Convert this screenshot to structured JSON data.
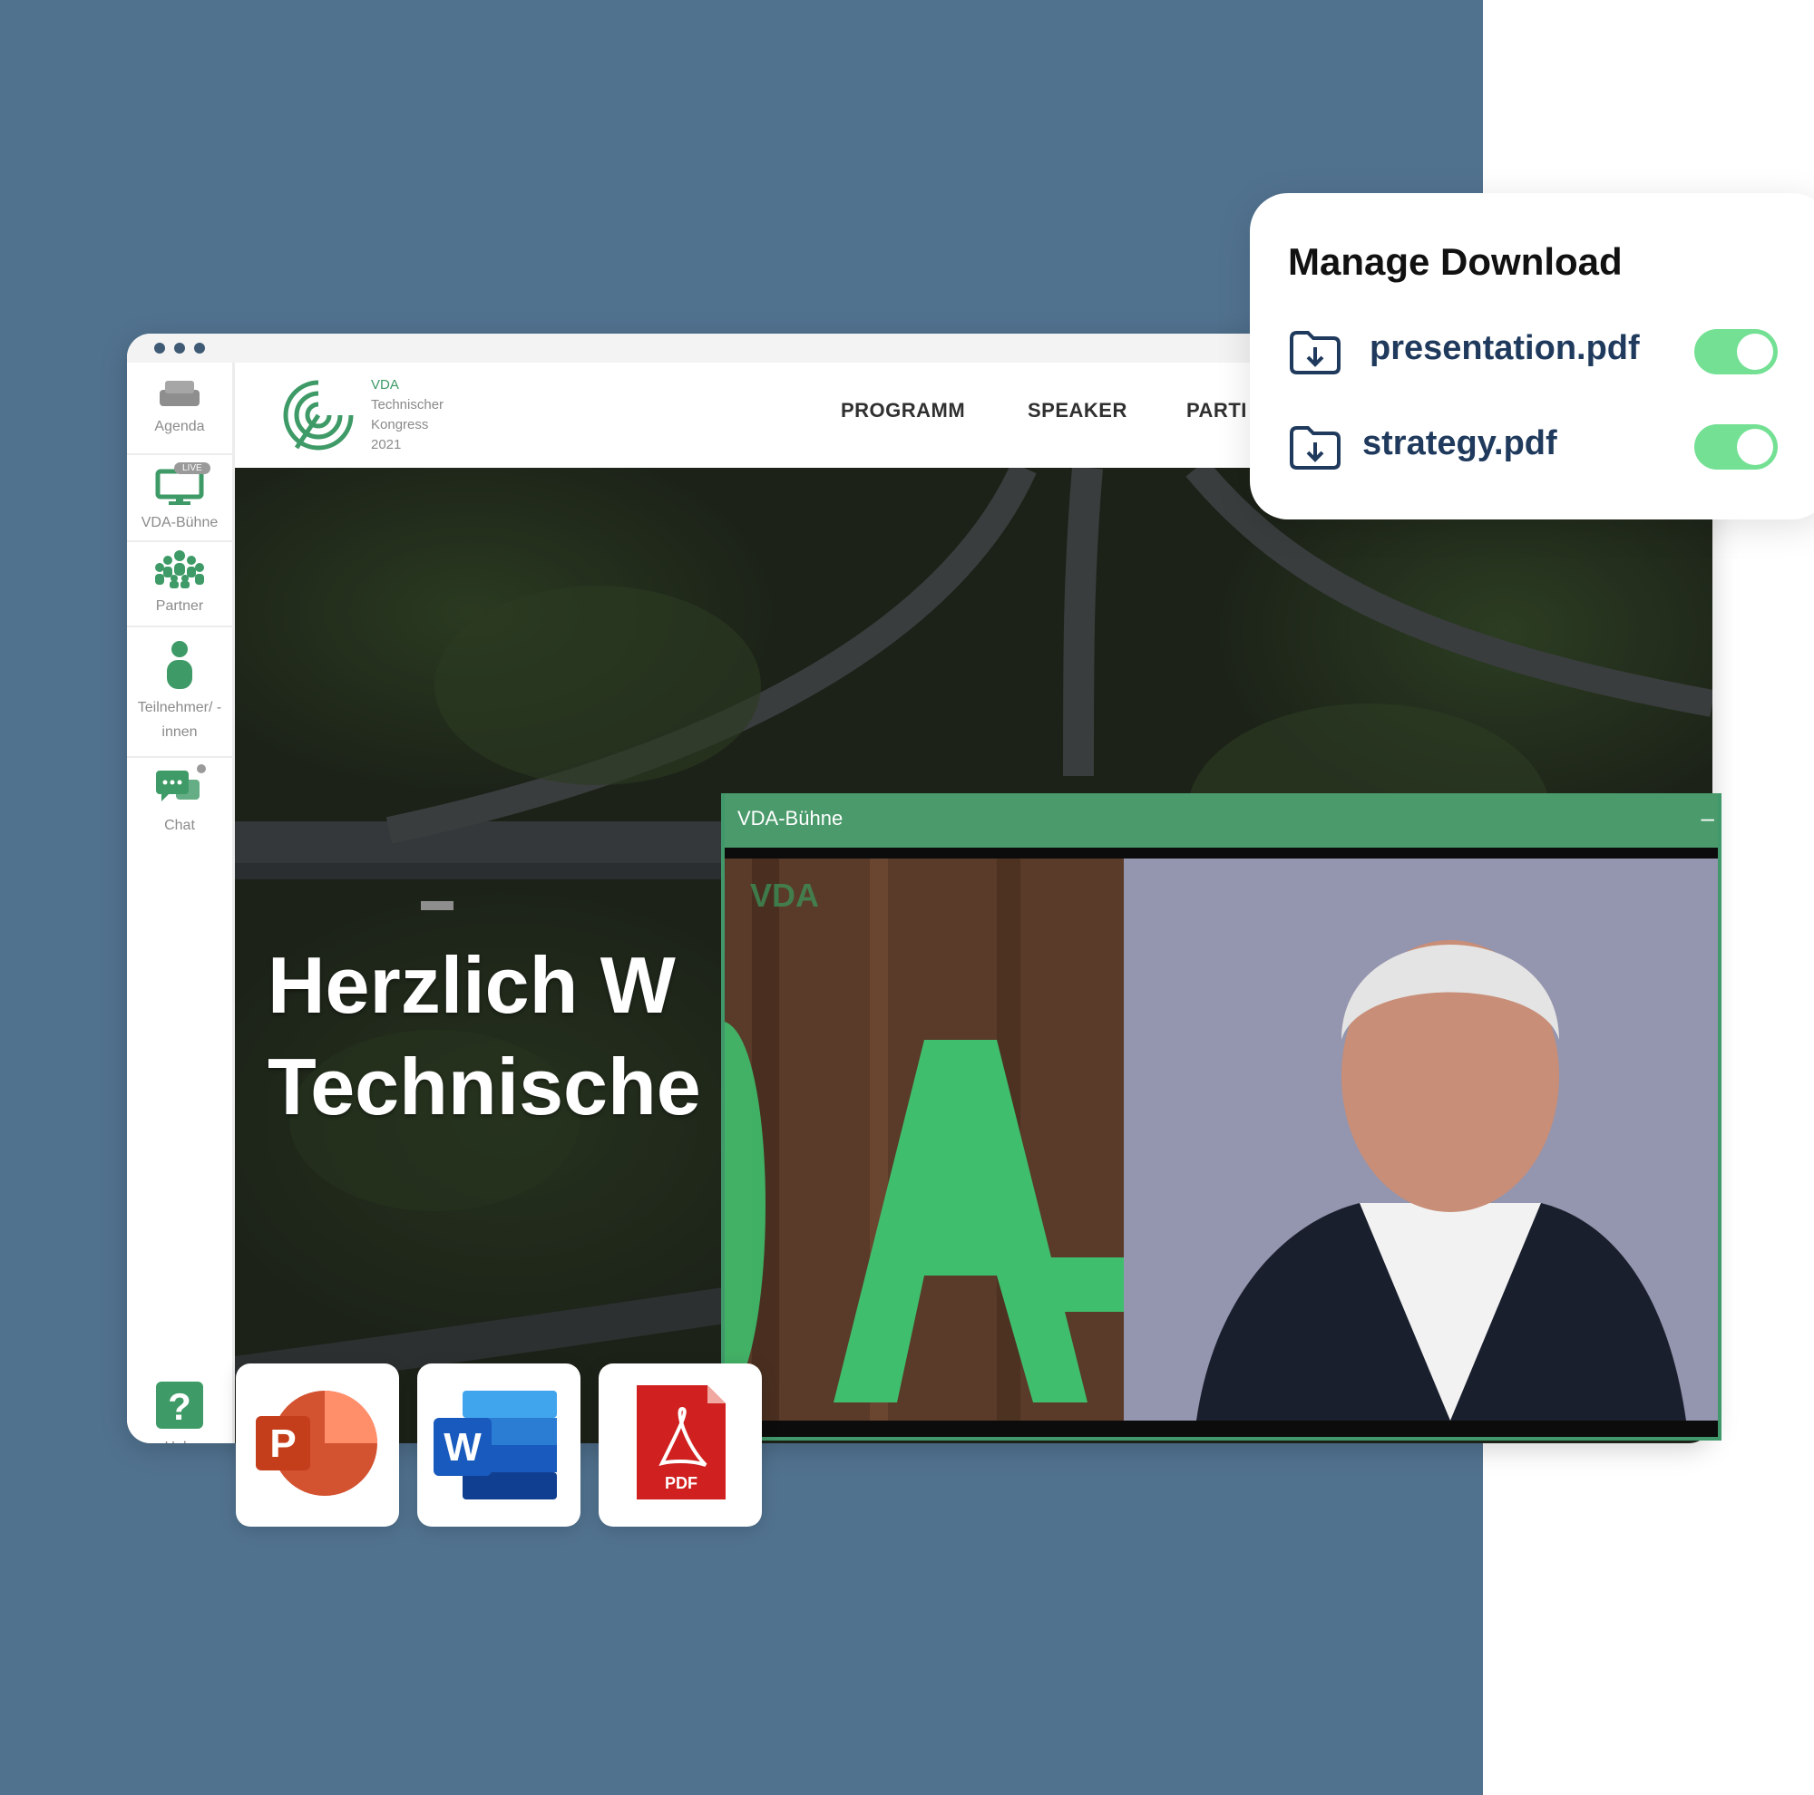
{
  "sidebar": {
    "items": [
      {
        "label": "Agenda",
        "icon": "agenda-icon"
      },
      {
        "label": "VDA-Bühne",
        "icon": "monitor-icon",
        "badge": "LIVE"
      },
      {
        "label": "Partner",
        "icon": "group-icon"
      },
      {
        "label_line1": "Teilnehmer/ -",
        "label_line2": "innen",
        "icon": "person-icon"
      },
      {
        "label": "Chat",
        "icon": "chat-icon"
      }
    ],
    "help": {
      "label": "Help",
      "icon": "help-icon"
    }
  },
  "site": {
    "logo_lines": [
      "VDA",
      "Technischer",
      "Kongress",
      "2021"
    ],
    "nav": [
      "PROGRAMM",
      "SPEAKER",
      "PARTI"
    ],
    "hero_line1": "Herzlich W",
    "hero_line2": "Technische"
  },
  "video": {
    "title": "VDA-Bühne",
    "minimize": "–",
    "screen_watermark": "VDA"
  },
  "files": [
    {
      "name": "powerpoint",
      "letter": "P",
      "icon": "powerpoint-icon"
    },
    {
      "name": "word",
      "letter": "W",
      "icon": "word-icon"
    },
    {
      "name": "pdf",
      "letter": "PDF",
      "icon": "pdf-icon"
    }
  ],
  "download_panel": {
    "title": "Manage Download",
    "files": [
      {
        "name": "presentation.pdf",
        "enabled": true
      },
      {
        "name": "strategy.pdf",
        "enabled": true
      }
    ]
  },
  "colors": {
    "background_blue": "#51728f",
    "accent_green": "#4a9a6b",
    "toggle_on": "#73e093",
    "file_name_color": "#1f3a5c"
  }
}
